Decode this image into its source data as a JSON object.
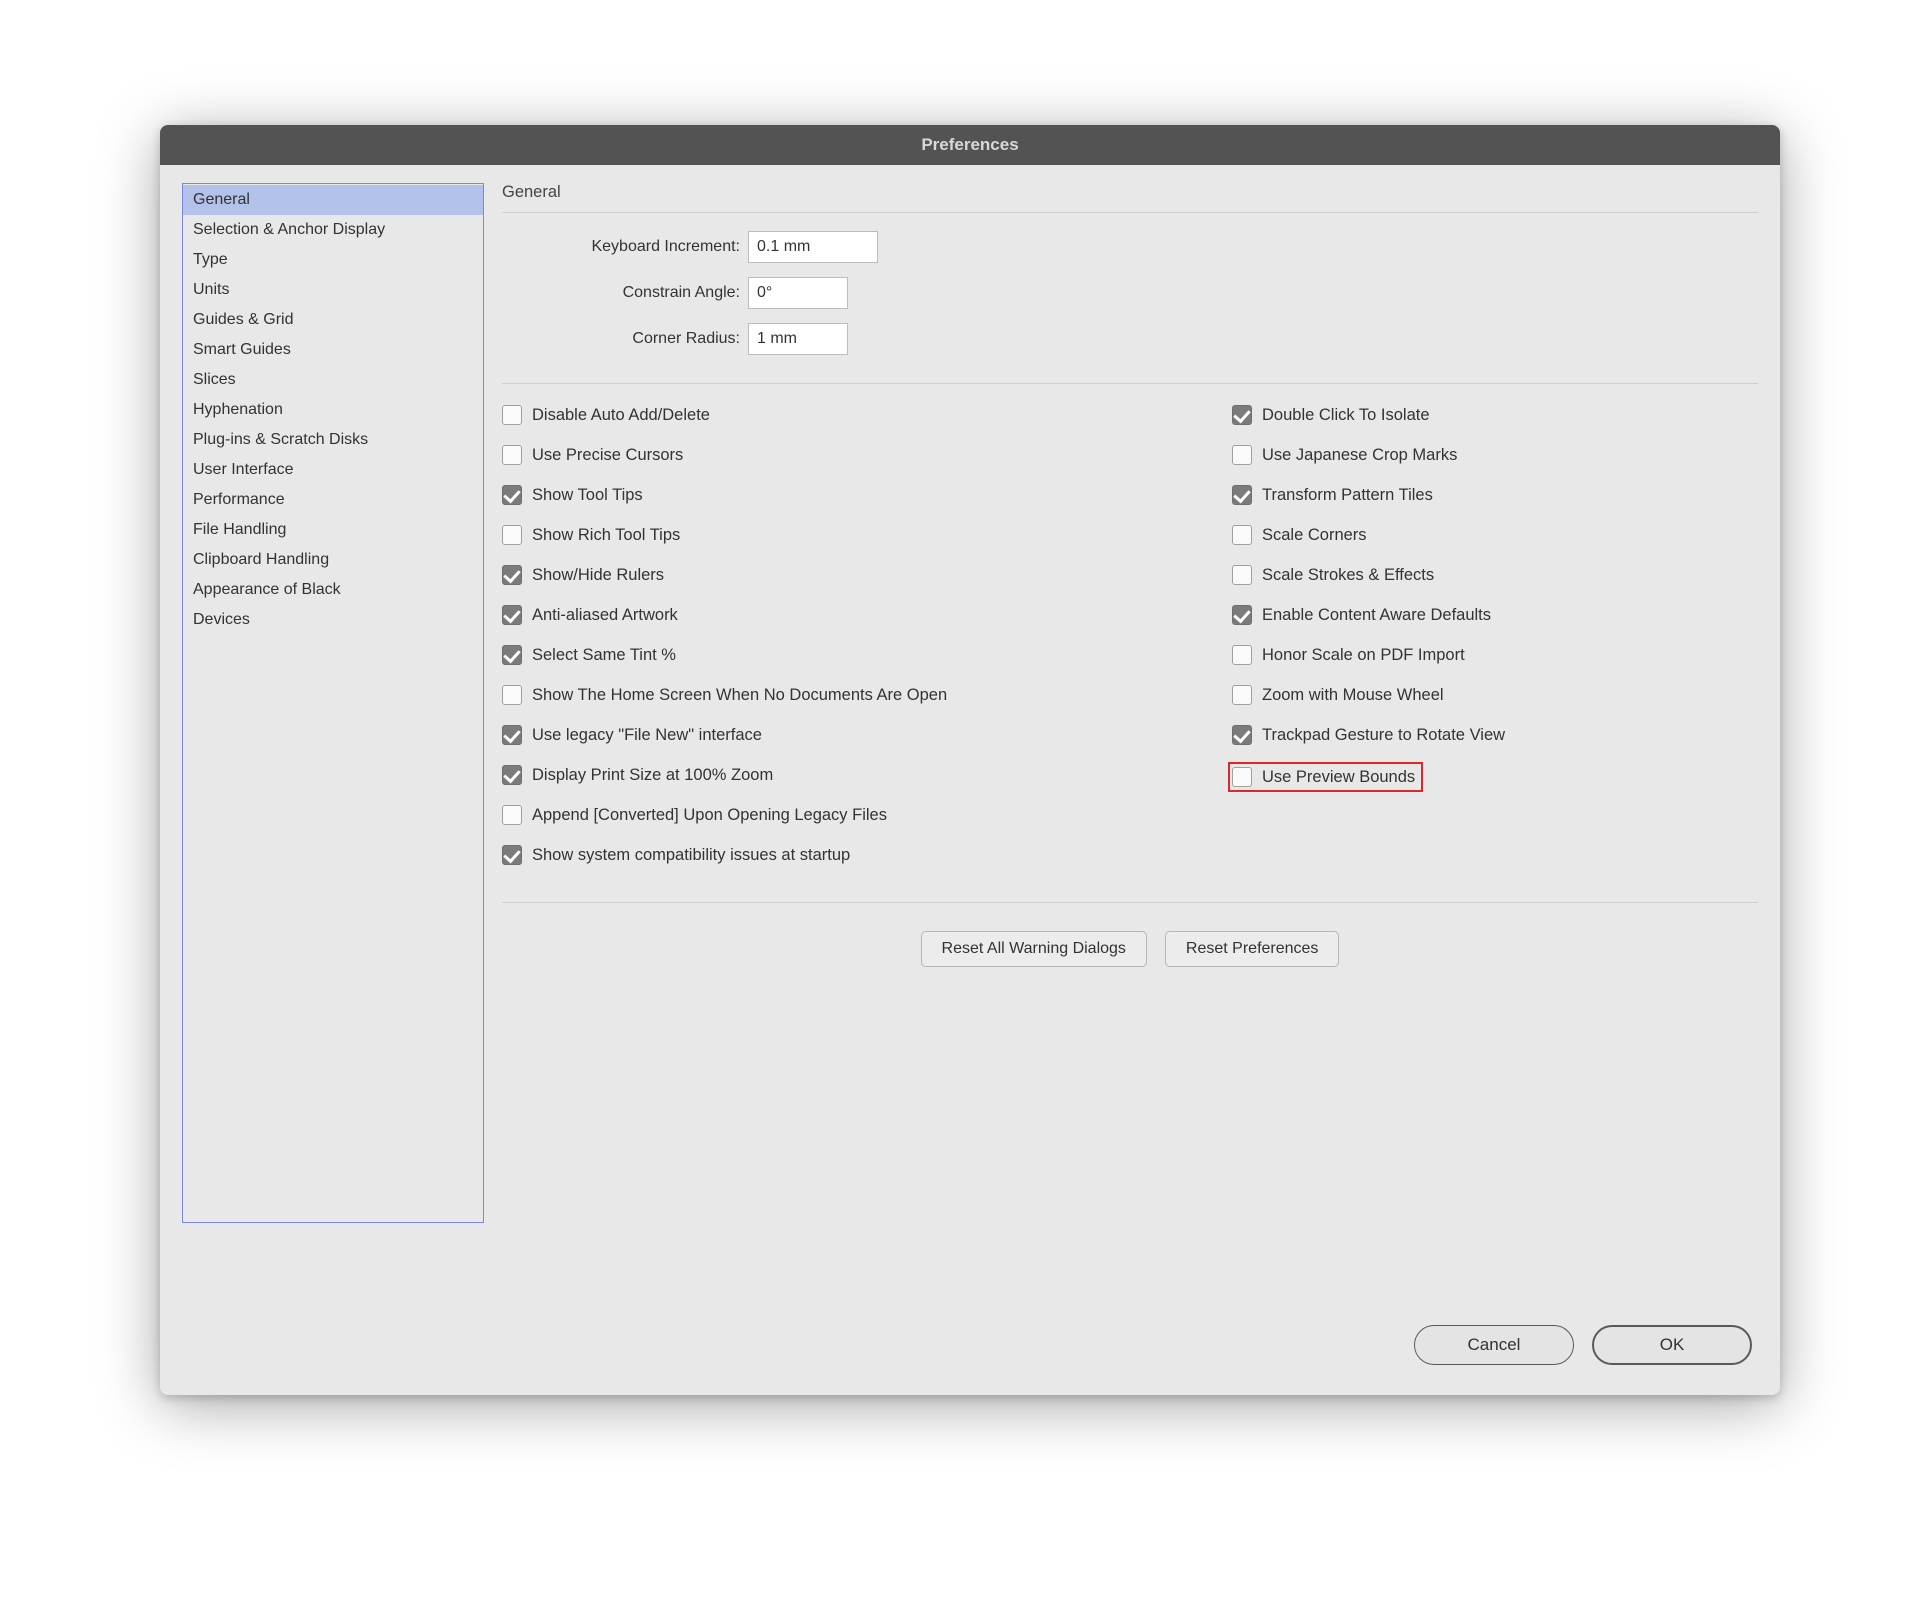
{
  "title": "Preferences",
  "sidebar": {
    "selectedIndex": 0,
    "items": [
      {
        "label": "General"
      },
      {
        "label": "Selection & Anchor Display"
      },
      {
        "label": "Type"
      },
      {
        "label": "Units"
      },
      {
        "label": "Guides & Grid"
      },
      {
        "label": "Smart Guides"
      },
      {
        "label": "Slices"
      },
      {
        "label": "Hyphenation"
      },
      {
        "label": "Plug-ins & Scratch Disks"
      },
      {
        "label": "User Interface"
      },
      {
        "label": "Performance"
      },
      {
        "label": "File Handling"
      },
      {
        "label": "Clipboard Handling"
      },
      {
        "label": "Appearance of Black"
      },
      {
        "label": "Devices"
      }
    ]
  },
  "section": {
    "heading": "General",
    "fields": {
      "keyboard_increment_label": "Keyboard Increment:",
      "keyboard_increment_value": "0.1 mm",
      "constrain_angle_label": "Constrain Angle:",
      "constrain_angle_value": "0°",
      "corner_radius_label": "Corner Radius:",
      "corner_radius_value": "1 mm"
    },
    "left_checks": [
      {
        "label": "Disable Auto Add/Delete",
        "checked": false
      },
      {
        "label": "Use Precise Cursors",
        "checked": false
      },
      {
        "label": "Show Tool Tips",
        "checked": true
      },
      {
        "label": "Show Rich Tool Tips",
        "checked": false
      },
      {
        "label": "Show/Hide Rulers",
        "checked": true
      },
      {
        "label": "Anti-aliased Artwork",
        "checked": true
      },
      {
        "label": "Select Same Tint %",
        "checked": true
      },
      {
        "label": "Show The Home Screen When No Documents Are Open",
        "checked": false
      },
      {
        "label": "Use legacy \"File New\" interface",
        "checked": true
      },
      {
        "label": "Display Print Size at 100% Zoom",
        "checked": true
      },
      {
        "label": "Append [Converted] Upon Opening Legacy Files",
        "checked": false
      },
      {
        "label": "Show system compatibility issues at startup",
        "checked": true
      }
    ],
    "right_checks": [
      {
        "label": "Double Click To Isolate",
        "checked": true
      },
      {
        "label": "Use Japanese Crop Marks",
        "checked": false
      },
      {
        "label": "Transform Pattern Tiles",
        "checked": true
      },
      {
        "label": "Scale Corners",
        "checked": false
      },
      {
        "label": "Scale Strokes & Effects",
        "checked": false
      },
      {
        "label": "Enable Content Aware Defaults",
        "checked": true
      },
      {
        "label": "Honor Scale on PDF Import",
        "checked": false
      },
      {
        "label": "Zoom with Mouse Wheel",
        "checked": false
      },
      {
        "label": "Trackpad Gesture to Rotate View",
        "checked": true
      },
      {
        "label": "Use Preview Bounds",
        "checked": false,
        "highlighted": true
      }
    ],
    "reset_warnings": "Reset All Warning Dialogs",
    "reset_prefs": "Reset Preferences"
  },
  "buttons": {
    "cancel": "Cancel",
    "ok": "OK"
  }
}
